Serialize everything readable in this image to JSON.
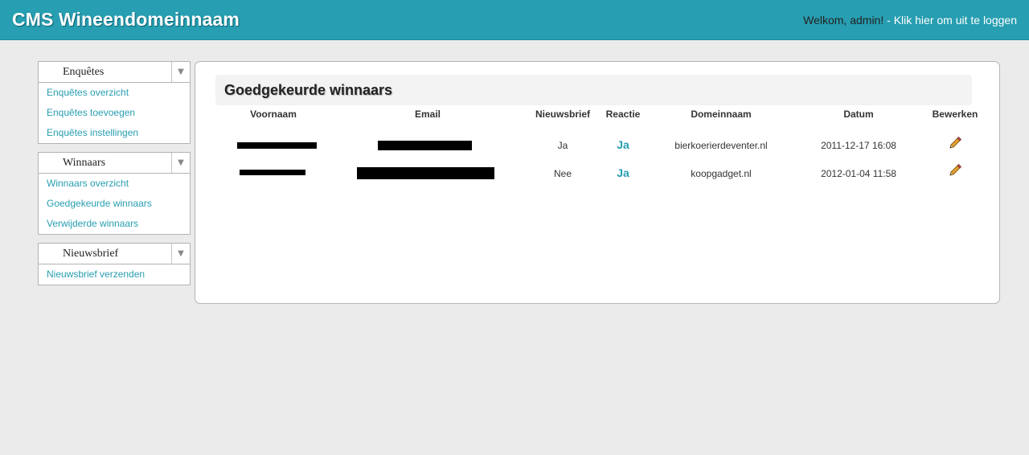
{
  "app": {
    "title": "CMS Wineendomeinnaam"
  },
  "userbar": {
    "greeting": "Welkom, admin!",
    "separator": " - ",
    "logout": "Klik hier om uit te loggen"
  },
  "sidebar": {
    "sections": [
      {
        "title": "Enquêtes",
        "items": [
          "Enquêtes overzicht",
          "Enquêtes toevoegen",
          "Enquêtes instellingen"
        ]
      },
      {
        "title": "Winnaars",
        "items": [
          "Winnaars overzicht",
          "Goedgekeurde winnaars",
          "Verwijderde winnaars"
        ]
      },
      {
        "title": "Nieuwsbrief",
        "items": [
          "Nieuwsbrief verzenden"
        ]
      }
    ],
    "toggle_icon": "triangle-down-icon"
  },
  "main": {
    "title": "Goedgekeurde winnaars",
    "columns": [
      "Voornaam",
      "Email",
      "Nieuwsbrief",
      "Reactie",
      "Domeinnaam",
      "Datum",
      "Bewerken"
    ],
    "rows": [
      {
        "nieuwsbrief": "Ja",
        "reactie": "Ja",
        "domein": "bierkoerierdeventer.nl",
        "datum": "2011-12-17 16:08"
      },
      {
        "nieuwsbrief": "Nee",
        "reactie": "Ja",
        "domein": "koopgadget.nl",
        "datum": "2012-01-04 11:58"
      }
    ],
    "edit_icon": "pencil-icon"
  },
  "colors": {
    "accent": "#279eb1",
    "background": "#ebebeb"
  }
}
